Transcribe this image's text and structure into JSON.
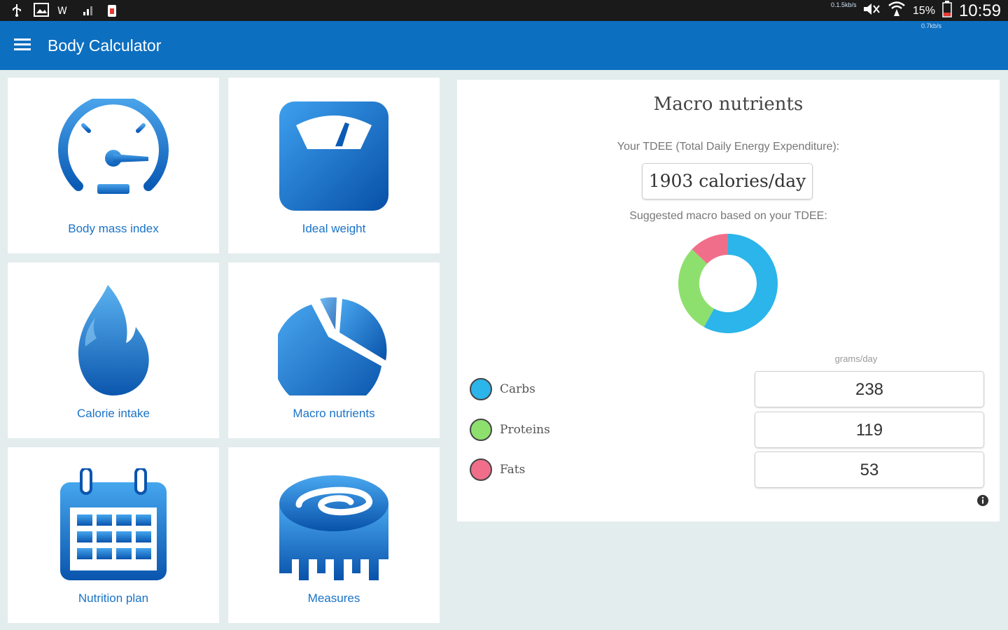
{
  "status_bar": {
    "battery": "15%",
    "time": "10:59",
    "netspeed_left": "0.1.5kb/s",
    "netspeed_right": "0.7kb/s"
  },
  "app_bar": {
    "title": "Body Calculator"
  },
  "tiles": [
    {
      "label": "Body mass index",
      "icon": "speedometer-icon"
    },
    {
      "label": "Ideal weight",
      "icon": "scale-icon"
    },
    {
      "label": "Calorie intake",
      "icon": "flame-icon"
    },
    {
      "label": "Macro nutrients",
      "icon": "pie-chart-icon"
    },
    {
      "label": "Nutrition plan",
      "icon": "calendar-icon"
    },
    {
      "label": "Measures",
      "icon": "measuring-tape-icon"
    }
  ],
  "panel": {
    "title": "Macro nutrients",
    "tdee_label": "Your TDEE (Total Daily Energy Expenditure):",
    "tdee_value": "1903 calories/day",
    "suggested_label": "Suggested macro based on your TDEE:",
    "units_label": "grams/day",
    "macros": [
      {
        "name": "Carbs",
        "value": "238",
        "color": "#2bb5ea"
      },
      {
        "name": "Proteins",
        "value": "119",
        "color": "#8ee06e"
      },
      {
        "name": "Fats",
        "value": "53",
        "color": "#f16e8a"
      }
    ]
  },
  "colors": {
    "app_bar": "#0d6fc0",
    "tile_label": "#1a73c7",
    "background": "#e3eded"
  }
}
